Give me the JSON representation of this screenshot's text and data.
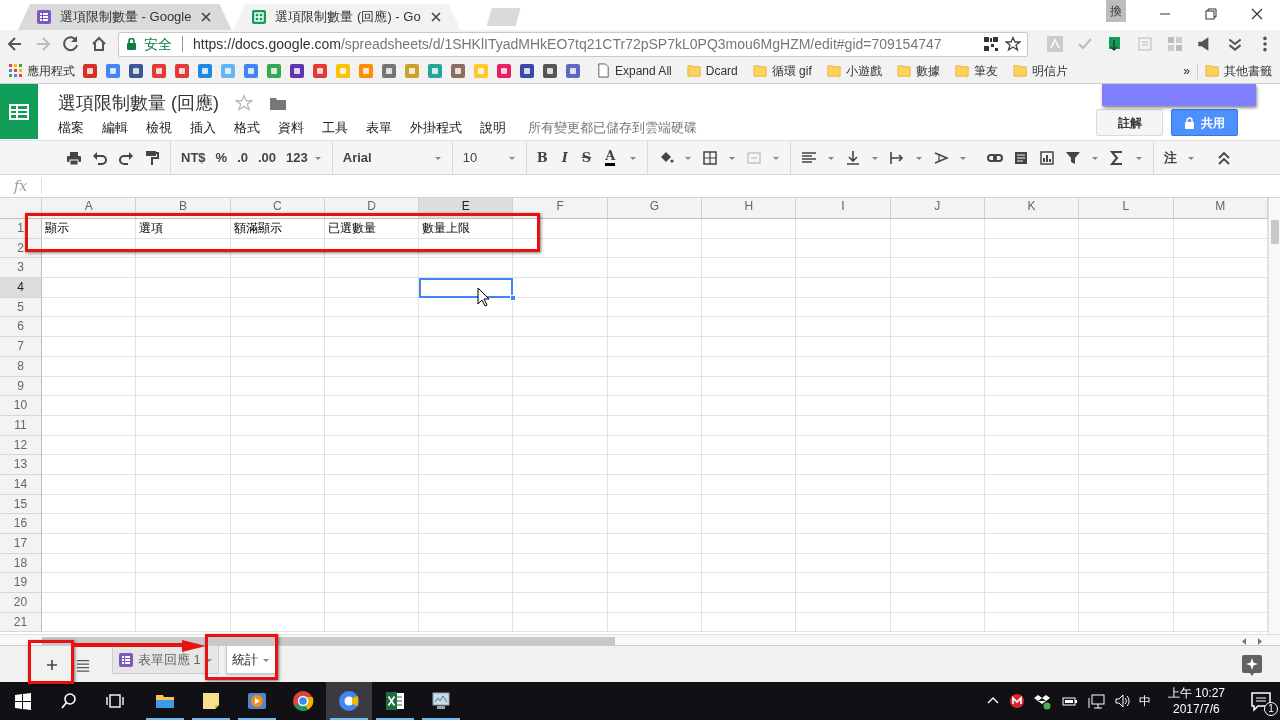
{
  "browser": {
    "tabs": [
      {
        "title": "選項限制數量 - Google",
        "selected": false,
        "kind": "form"
      },
      {
        "title": "選項限制數量 (回應) - Go",
        "selected": true,
        "kind": "sheet"
      }
    ],
    "ime_indicator": "換",
    "security_label": "安全",
    "url": {
      "host": "https://docs.google.com",
      "path": "/spreadsheets/d/1SHKlITyadMHkEO7tq21CTr72pSP7kL0PQ3mou6MgHZM/edit#gid=709154747"
    },
    "bookmarks": {
      "apps_label": "應用程式",
      "items": [
        {
          "label": "Expand All",
          "kind": "page"
        },
        {
          "label": "Dcard",
          "kind": "folder"
        },
        {
          "label": "循環 gif",
          "kind": "folder"
        },
        {
          "label": "小遊戲",
          "kind": "folder"
        },
        {
          "label": "數據",
          "kind": "folder"
        },
        {
          "label": "筆友",
          "kind": "folder"
        },
        {
          "label": "明信片",
          "kind": "folder"
        }
      ],
      "overflow": "»",
      "other": "其他書籤"
    }
  },
  "sheets": {
    "title": "選項限制數量 (回應)",
    "starred": false,
    "menus": [
      "檔案",
      "編輯",
      "檢視",
      "插入",
      "格式",
      "資料",
      "工具",
      "表單",
      "外掛程式",
      "說明"
    ],
    "save_status": "所有變更都已儲存到雲端硬碟",
    "comment_button": "註解",
    "share_button": "共用"
  },
  "toolbar": {
    "number_formats": [
      "NT$",
      "%",
      ".0",
      ".00"
    ],
    "more_formats": "123",
    "font": "Arial",
    "font_size": "10",
    "text_styles": [
      "B",
      "I",
      "S",
      "A"
    ],
    "input_tools": "注"
  },
  "formula_bar": {
    "label": "fx"
  },
  "grid": {
    "columns": [
      {
        "label": "A",
        "selected": false
      },
      {
        "label": "B",
        "selected": false
      },
      {
        "label": "C",
        "selected": false
      },
      {
        "label": "D",
        "selected": false
      },
      {
        "label": "E",
        "selected": true
      },
      {
        "label": "F",
        "selected": false
      },
      {
        "label": "G",
        "selected": false
      },
      {
        "label": "H",
        "selected": false
      },
      {
        "label": "I",
        "selected": false
      },
      {
        "label": "J",
        "selected": false
      },
      {
        "label": "K",
        "selected": false
      },
      {
        "label": "L",
        "selected": false
      },
      {
        "label": "M",
        "selected": false
      }
    ],
    "rows": [
      {
        "header": "1",
        "selected": false,
        "cells": [
          "顯示",
          "選項",
          "額滿顯示",
          "已選數量",
          "數量上限"
        ]
      },
      {
        "header": "2",
        "selected": false
      },
      {
        "header": "3",
        "selected": false
      },
      {
        "header": "4",
        "selected": true
      },
      {
        "header": "5",
        "selected": false
      },
      {
        "header": "6",
        "selected": false
      },
      {
        "header": "7",
        "selected": false
      },
      {
        "header": "8",
        "selected": false
      },
      {
        "header": "9",
        "selected": false
      },
      {
        "header": "10",
        "selected": false
      },
      {
        "header": "11",
        "selected": false
      },
      {
        "header": "12",
        "selected": false
      },
      {
        "header": "13",
        "selected": false
      },
      {
        "header": "14",
        "selected": false
      },
      {
        "header": "15",
        "selected": false
      },
      {
        "header": "16",
        "selected": false
      },
      {
        "header": "17",
        "selected": false
      },
      {
        "header": "18",
        "selected": false
      },
      {
        "header": "19",
        "selected": false
      },
      {
        "header": "20",
        "selected": false
      },
      {
        "header": "21",
        "selected": false
      }
    ]
  },
  "sheet_tabs": [
    {
      "label": "表單回應 1",
      "selected": false,
      "kind": "form"
    },
    {
      "label": "統計",
      "selected": true,
      "kind": "plain"
    }
  ],
  "taskbar": {
    "apps": [
      {
        "kind": "explorer",
        "running": true,
        "selected": false
      },
      {
        "kind": "notes",
        "running": true,
        "selected": false
      },
      {
        "kind": "player",
        "running": true,
        "selected": false
      },
      {
        "kind": "chrome",
        "running": false,
        "selected": false
      },
      {
        "kind": "canary",
        "running": true,
        "selected": true
      },
      {
        "kind": "excel",
        "running": true,
        "selected": false
      },
      {
        "kind": "monitor",
        "running": true,
        "selected": false
      }
    ],
    "input_language": "中",
    "time": "上午 10:27",
    "date": "2017/7/6",
    "notifications": "1"
  }
}
